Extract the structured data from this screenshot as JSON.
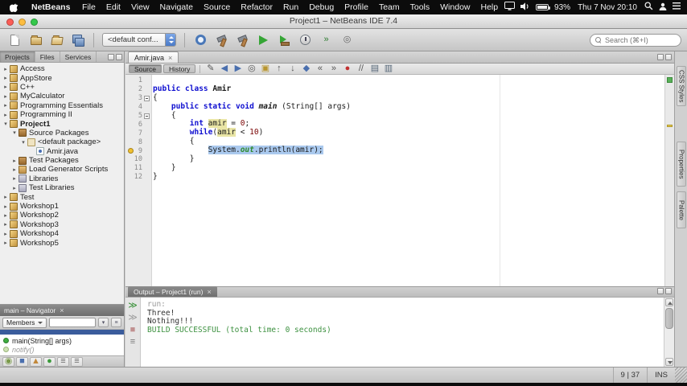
{
  "colors": {
    "kw": "#0f0fd0",
    "num": "#780000",
    "fld": "#2e8b2e",
    "sel": "#aac9ee",
    "occ": "#e9e5a5",
    "ok": "#3d9140",
    "bulb": "#f0c030"
  },
  "menubar": {
    "app_name": "NetBeans",
    "menus": [
      "File",
      "Edit",
      "View",
      "Navigate",
      "Source",
      "Refactor",
      "Run",
      "Debug",
      "Profile",
      "Team",
      "Tools",
      "Window",
      "Help"
    ],
    "battery": "93%",
    "clock": "Thu 7 Nov 20:10"
  },
  "titlebar": {
    "title": "Project1 – NetBeans IDE 7.4"
  },
  "toolbar": {
    "config": "<default conf...",
    "search_placeholder": "Search (⌘+I)",
    "file_icons": [
      {
        "name": "new-file-icon",
        "type": "page"
      },
      {
        "name": "new-project-icon",
        "type": "folder"
      },
      {
        "name": "open-project-icon",
        "type": "folder-open"
      },
      {
        "name": "save-all-icon",
        "type": "disks"
      }
    ],
    "run_icons": [
      {
        "name": "memory-gauge-icon",
        "type": "gauge"
      },
      {
        "name": "clean-build-icon",
        "type": "hammer"
      },
      {
        "name": "build-icon",
        "type": "hammer"
      },
      {
        "name": "run-icon",
        "type": "play"
      },
      {
        "name": "debug-icon",
        "type": "playdbg"
      },
      {
        "name": "profile-icon",
        "type": "profile"
      },
      {
        "name": "apply-changes-icon",
        "type": "glyph",
        "g": "»",
        "col": "#2e7d32"
      },
      {
        "name": "attach-profiler-icon",
        "type": "glyph",
        "g": "◎",
        "col": "#666666"
      }
    ]
  },
  "projects": {
    "tabs": [
      "Projects",
      "Files",
      "Services"
    ],
    "tree": [
      {
        "label": "Access",
        "indent": 0,
        "arrow": "▸",
        "icon": "project"
      },
      {
        "label": "AppStore",
        "indent": 0,
        "arrow": "▸",
        "icon": "project"
      },
      {
        "label": "C++",
        "indent": 0,
        "arrow": "▸",
        "icon": "project"
      },
      {
        "label": "MyCalculator",
        "indent": 0,
        "arrow": "▸",
        "icon": "project"
      },
      {
        "label": "Programming Essentials",
        "indent": 0,
        "arrow": "▸",
        "icon": "project"
      },
      {
        "label": "Programming II",
        "indent": 0,
        "arrow": "▸",
        "icon": "project"
      },
      {
        "label": "Project1",
        "indent": 0,
        "arrow": "▾",
        "icon": "project",
        "bold": true
      },
      {
        "label": "Source Packages",
        "indent": 1,
        "arrow": "▾",
        "icon": "srcpkg"
      },
      {
        "label": "<default package>",
        "indent": 2,
        "arrow": "▾",
        "icon": "pkg"
      },
      {
        "label": "Amir.java",
        "indent": 3,
        "arrow": "",
        "icon": "java"
      },
      {
        "label": "Test Packages",
        "indent": 1,
        "arrow": "▸",
        "icon": "srcpkg"
      },
      {
        "label": "Load Generator Scripts",
        "indent": 1,
        "arrow": "▸",
        "icon": "folder"
      },
      {
        "label": "Libraries",
        "indent": 1,
        "arrow": "▸",
        "icon": "lib"
      },
      {
        "label": "Test Libraries",
        "indent": 1,
        "arrow": "▸",
        "icon": "lib"
      },
      {
        "label": "Test",
        "indent": 0,
        "arrow": "▸",
        "icon": "project"
      },
      {
        "label": "Workshop1",
        "indent": 0,
        "arrow": "▸",
        "icon": "project"
      },
      {
        "label": "Workshop2",
        "indent": 0,
        "arrow": "▸",
        "icon": "project"
      },
      {
        "label": "Workshop3",
        "indent": 0,
        "arrow": "▸",
        "icon": "project"
      },
      {
        "label": "Workshop4",
        "indent": 0,
        "arrow": "▸",
        "icon": "project"
      },
      {
        "label": "Workshop5",
        "indent": 0,
        "arrow": "▸",
        "icon": "project"
      }
    ]
  },
  "editor": {
    "tab": "Amir.java",
    "subtabs": [
      "Source",
      "History"
    ],
    "toolbar_icons": [
      {
        "name": "last-edit-icon",
        "g": "✎",
        "col": "#555555"
      },
      {
        "name": "back-icon",
        "g": "◀",
        "col": "#4a6fae"
      },
      {
        "name": "forward-icon",
        "g": "▶",
        "col": "#4a6fae"
      },
      {
        "name": "find-selection-icon",
        "g": "◎",
        "col": "#555555"
      },
      {
        "name": "highlight-occurrences-icon",
        "g": "▣",
        "col": "#b8952e"
      },
      {
        "name": "prev-occurrence-icon",
        "g": "↑",
        "col": "#555555"
      },
      {
        "name": "next-occurrence-icon",
        "g": "↓",
        "col": "#555555"
      },
      {
        "name": "toggle-bookmark-icon",
        "g": "◆",
        "col": "#4a6fae"
      },
      {
        "name": "prev-bookmark-icon",
        "g": "«",
        "col": "#555555"
      },
      {
        "name": "next-bookmark-icon",
        "g": "»",
        "col": "#555555"
      },
      {
        "name": "record-macro-icon",
        "g": "●",
        "col": "#c23030"
      },
      {
        "name": "comment-icon",
        "g": "//",
        "col": "#555555"
      },
      {
        "name": "diff-icon",
        "g": "▤",
        "col": "#556677"
      },
      {
        "name": "history-diff-icon",
        "g": "▥",
        "col": "#556677"
      }
    ],
    "code": [
      {
        "n": "1",
        "tokens": []
      },
      {
        "n": "2",
        "tokens": [
          {
            "t": "public class ",
            "c": "kw"
          },
          {
            "t": "Amir",
            "c": "cls"
          }
        ]
      },
      {
        "n": "3",
        "tokens": [
          {
            "t": "{",
            "c": "pl"
          }
        ],
        "fold": true
      },
      {
        "n": "4",
        "tokens": [
          {
            "t": "    ",
            "c": "pl"
          },
          {
            "t": "public static void ",
            "c": "kw"
          },
          {
            "t": "main",
            "c": "mth"
          },
          {
            "t": " (String[] args)",
            "c": "pl"
          }
        ]
      },
      {
        "n": "5",
        "tokens": [
          {
            "t": "    {",
            "c": "pl"
          }
        ],
        "fold": true
      },
      {
        "n": "6",
        "tokens": [
          {
            "t": "        ",
            "c": "pl"
          },
          {
            "t": "int",
            "c": "kw"
          },
          {
            "t": " ",
            "c": "pl"
          },
          {
            "t": "amir",
            "c": "occ"
          },
          {
            "t": " = ",
            "c": "pl"
          },
          {
            "t": "0",
            "c": "num"
          },
          {
            "t": ";",
            "c": "pl"
          }
        ]
      },
      {
        "n": "7",
        "tokens": [
          {
            "t": "        ",
            "c": "pl"
          },
          {
            "t": "while",
            "c": "kw"
          },
          {
            "t": "(",
            "c": "pl"
          },
          {
            "t": "amir",
            "c": "occ"
          },
          {
            "t": " < ",
            "c": "pl"
          },
          {
            "t": "10",
            "c": "num"
          },
          {
            "t": ")",
            "c": "pl"
          }
        ]
      },
      {
        "n": "8",
        "tokens": [
          {
            "t": "        {",
            "c": "pl"
          }
        ]
      },
      {
        "n": "9",
        "tokens": [
          {
            "t": "            ",
            "c": "pl"
          },
          {
            "t": "System.",
            "c": "pl sel"
          },
          {
            "t": "out",
            "c": "fld sel"
          },
          {
            "t": ".println(amir);",
            "c": "pl sel"
          }
        ],
        "bulb": true
      },
      {
        "n": "10",
        "tokens": [
          {
            "t": "        }",
            "c": "pl"
          }
        ]
      },
      {
        "n": "11",
        "tokens": [
          {
            "t": "    }",
            "c": "pl"
          }
        ]
      },
      {
        "n": "12",
        "tokens": [
          {
            "t": "}",
            "c": "pl"
          }
        ]
      }
    ]
  },
  "output": {
    "tab": "Output – Project1 (run)",
    "action_icons": [
      {
        "name": "rerun-icon",
        "g": "≫",
        "col": "#2e8b2e"
      },
      {
        "name": "rerun-debug-icon",
        "g": "≫",
        "col": "#999999"
      },
      {
        "name": "stop-icon",
        "g": "■",
        "col": "#c09090"
      },
      {
        "name": "ant-settings-icon",
        "g": "≡",
        "col": "#777777"
      }
    ],
    "lines": [
      {
        "t": "run:",
        "c": "dim"
      },
      {
        "t": "Three!",
        "c": "std"
      },
      {
        "t": "Nothing!!!",
        "c": "std"
      },
      {
        "t": "BUILD SUCCESSFUL (total time: 0 seconds)",
        "c": "ok"
      }
    ]
  },
  "navigator": {
    "tab": "main – Navigator",
    "combo": "Members",
    "items": [
      {
        "t": "",
        "c": "clipped",
        "icon": ""
      },
      {
        "t": "main(String[] args)",
        "c": "member",
        "icon": "method"
      },
      {
        "t": "notify()",
        "c": "inherited",
        "icon": "inherited"
      }
    ],
    "filter_icons": [
      {
        "name": "show-inherited-icon",
        "g": "◉",
        "col": "#7a9a4a"
      },
      {
        "name": "show-fields-icon",
        "g": "■",
        "col": "#4a6fae"
      },
      {
        "name": "show-static-icon",
        "g": "▲",
        "col": "#c2883a"
      },
      {
        "name": "show-public-only-icon",
        "g": "●",
        "col": "#3a9a3a"
      },
      {
        "name": "sort-alpha-icon",
        "g": "≡",
        "col": "#666666"
      },
      {
        "name": "sort-source-icon",
        "g": "≡",
        "col": "#666666"
      }
    ]
  },
  "right_tabs": [
    "CSS Styles",
    "Properties",
    "Palette"
  ],
  "statusbar": {
    "caret": "9 | 37",
    "mode": "INS"
  }
}
